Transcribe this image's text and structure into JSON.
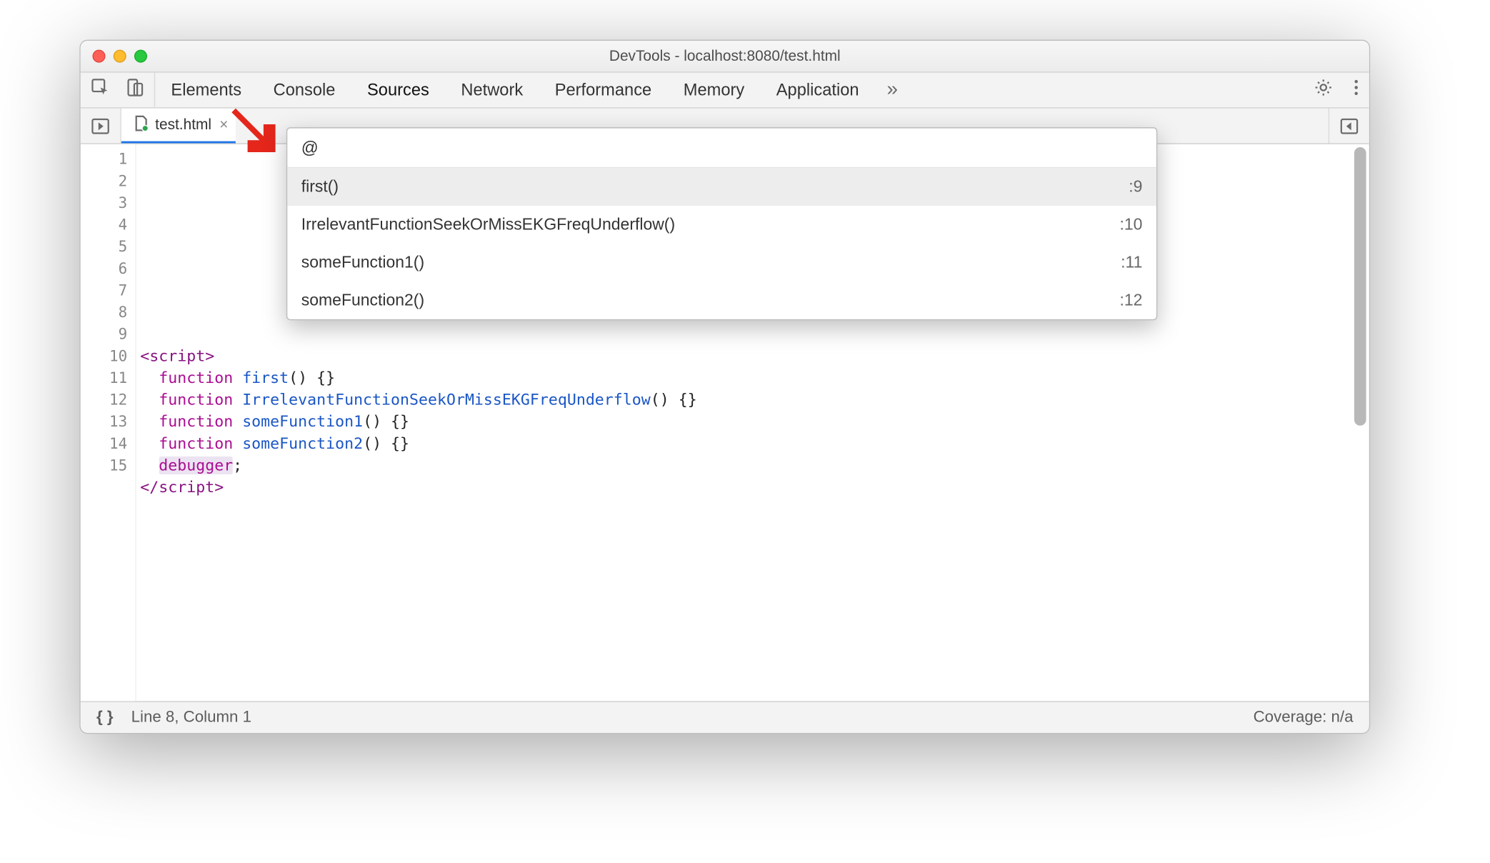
{
  "window": {
    "title": "DevTools - localhost:8080/test.html"
  },
  "tabs": {
    "items": [
      {
        "label": "Elements"
      },
      {
        "label": "Console"
      },
      {
        "label": "Sources"
      },
      {
        "label": "Network"
      },
      {
        "label": "Performance"
      },
      {
        "label": "Memory"
      },
      {
        "label": "Application"
      }
    ],
    "overflow_glyph": "»"
  },
  "file_tab": {
    "name": "test.html",
    "close_glyph": "×"
  },
  "outline": {
    "query": "@",
    "items": [
      {
        "label": "first()",
        "line": ":9"
      },
      {
        "label": "IrrelevantFunctionSeekOrMissEKGFreqUnderflow()",
        "line": ":10"
      },
      {
        "label": "someFunction1()",
        "line": ":11"
      },
      {
        "label": "someFunction2()",
        "line": ":12"
      }
    ]
  },
  "code": {
    "line_count": 15,
    "lines": [
      {
        "n": 1
      },
      {
        "n": 2
      },
      {
        "n": 3
      },
      {
        "n": 4
      },
      {
        "n": 5
      },
      {
        "n": 6
      },
      {
        "n": 7
      },
      {
        "n": 8
      },
      {
        "n": 9
      },
      {
        "n": 10
      },
      {
        "n": 11
      },
      {
        "n": 12
      },
      {
        "n": 13
      },
      {
        "n": 14
      },
      {
        "n": 15
      }
    ],
    "tokens_8": [
      {
        "t": "<script>",
        "c": "tag"
      }
    ],
    "tokens_9": [
      {
        "t": "  ",
        "c": ""
      },
      {
        "t": "function",
        "c": "kw"
      },
      {
        "t": " ",
        "c": ""
      },
      {
        "t": "first",
        "c": "fn"
      },
      {
        "t": "() {}",
        "c": "punct"
      }
    ],
    "tokens_10": [
      {
        "t": "  ",
        "c": ""
      },
      {
        "t": "function",
        "c": "kw"
      },
      {
        "t": " ",
        "c": ""
      },
      {
        "t": "IrrelevantFunctionSeekOrMissEKGFreqUnderflow",
        "c": "fn"
      },
      {
        "t": "() {}",
        "c": "punct"
      }
    ],
    "tokens_11": [
      {
        "t": "  ",
        "c": ""
      },
      {
        "t": "function",
        "c": "kw"
      },
      {
        "t": " ",
        "c": ""
      },
      {
        "t": "someFunction1",
        "c": "fn"
      },
      {
        "t": "() {}",
        "c": "punct"
      }
    ],
    "tokens_12": [
      {
        "t": "  ",
        "c": ""
      },
      {
        "t": "function",
        "c": "kw"
      },
      {
        "t": " ",
        "c": ""
      },
      {
        "t": "someFunction2",
        "c": "fn"
      },
      {
        "t": "() {}",
        "c": "punct"
      }
    ],
    "tokens_13": [
      {
        "t": "  ",
        "c": ""
      },
      {
        "t": "debugger",
        "c": "debugger"
      },
      {
        "t": ";",
        "c": "punct"
      }
    ],
    "tokens_14": [
      {
        "t": "</scr",
        "c": "tag"
      },
      {
        "t": "ipt>",
        "c": "tag"
      }
    ]
  },
  "status": {
    "braces": "{ }",
    "pos": "Line 8, Column 1",
    "coverage": "Coverage: n/a"
  }
}
